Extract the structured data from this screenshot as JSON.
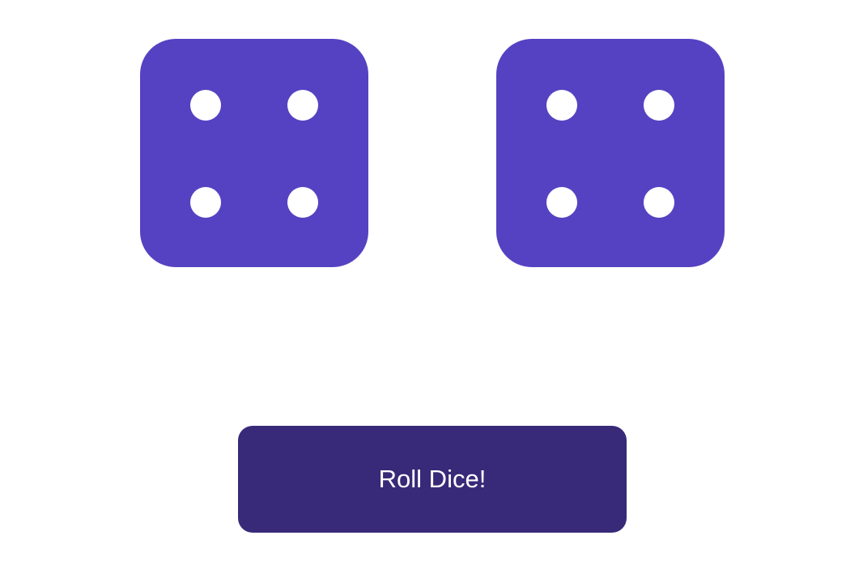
{
  "colors": {
    "die_face": "#5542c2",
    "pip": "#ffffff",
    "button_background": "#382a78",
    "button_text": "#ffffff",
    "page_background": "#ffffff"
  },
  "dice": [
    {
      "value": 4,
      "icon": "dice-four-icon"
    },
    {
      "value": 4,
      "icon": "dice-four-icon"
    }
  ],
  "roll_button": {
    "label": "Roll Dice!"
  }
}
